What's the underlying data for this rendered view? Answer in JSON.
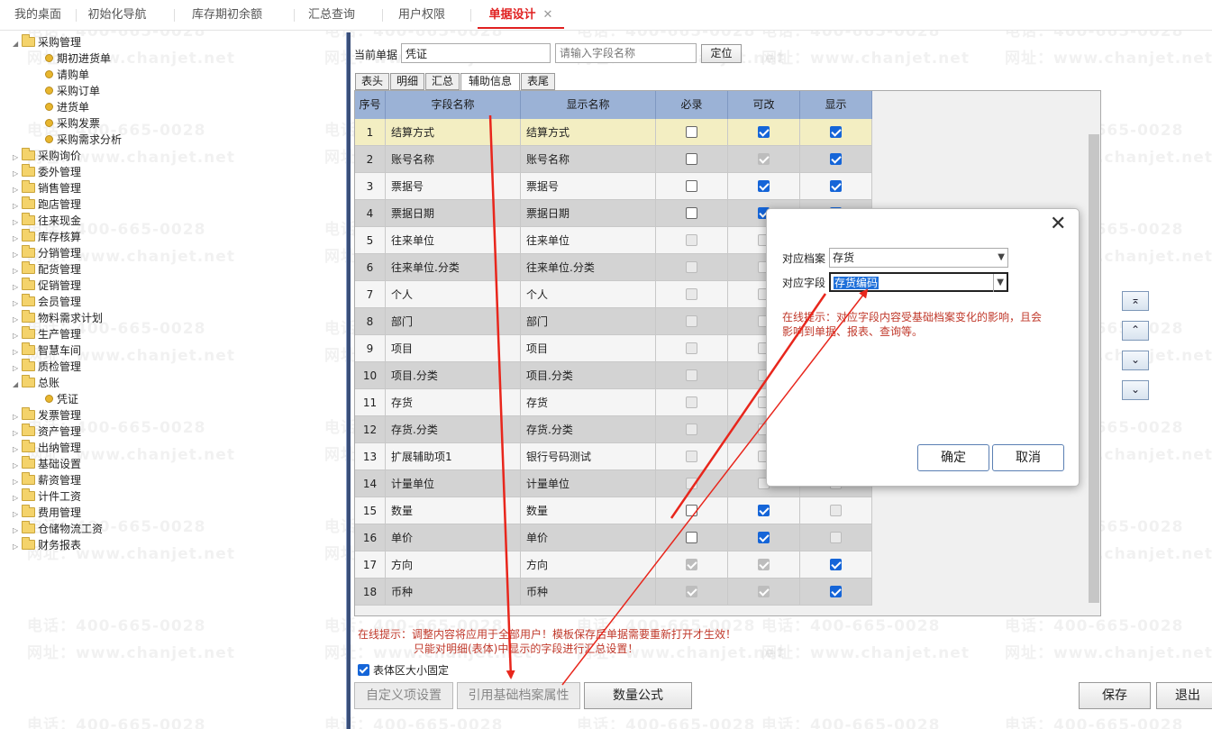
{
  "top_tabs": [
    {
      "label": "我的桌面",
      "active": false
    },
    {
      "label": "初始化导航",
      "active": false
    },
    {
      "label": "库存期初余额",
      "active": false
    },
    {
      "label": "汇总查询",
      "active": false
    },
    {
      "label": "用户权限",
      "active": false
    },
    {
      "label": "单据设计",
      "active": true
    }
  ],
  "tab_close_glyph": "✕",
  "tree": [
    {
      "label": "采购管理",
      "level": 0,
      "expanded": true
    },
    {
      "label": "期初进货单",
      "level": 1
    },
    {
      "label": "请购单",
      "level": 1
    },
    {
      "label": "采购订单",
      "level": 1
    },
    {
      "label": "进货单",
      "level": 1
    },
    {
      "label": "采购发票",
      "level": 1
    },
    {
      "label": "采购需求分析",
      "level": 1
    },
    {
      "label": "采购询价",
      "level": 0
    },
    {
      "label": "委外管理",
      "level": 0
    },
    {
      "label": "销售管理",
      "level": 0
    },
    {
      "label": "跑店管理",
      "level": 0
    },
    {
      "label": "往来现金",
      "level": 0
    },
    {
      "label": "库存核算",
      "level": 0
    },
    {
      "label": "分销管理",
      "level": 0
    },
    {
      "label": "配货管理",
      "level": 0
    },
    {
      "label": "促销管理",
      "level": 0
    },
    {
      "label": "会员管理",
      "level": 0
    },
    {
      "label": "物料需求计划",
      "level": 0
    },
    {
      "label": "生产管理",
      "level": 0
    },
    {
      "label": "智慧车间",
      "level": 0
    },
    {
      "label": "质检管理",
      "level": 0
    },
    {
      "label": "总账",
      "level": 0,
      "expanded": true
    },
    {
      "label": "凭证",
      "level": 1
    },
    {
      "label": "发票管理",
      "level": 0
    },
    {
      "label": "资产管理",
      "level": 0
    },
    {
      "label": "出纳管理",
      "level": 0
    },
    {
      "label": "基础设置",
      "level": 0
    },
    {
      "label": "薪资管理",
      "level": 0
    },
    {
      "label": "计件工资",
      "level": 0
    },
    {
      "label": "费用管理",
      "level": 0
    },
    {
      "label": "仓储物流工资",
      "level": 0
    },
    {
      "label": "财务报表",
      "level": 0
    }
  ],
  "current_doc": {
    "label": "当前单据",
    "value": "凭证",
    "field_search_placeholder": "请输入字段名称",
    "locate_button": "定位"
  },
  "sub_tabs": [
    {
      "label": "表头",
      "active": false
    },
    {
      "label": "明细",
      "active": false
    },
    {
      "label": "汇总",
      "active": false
    },
    {
      "label": "辅助信息",
      "active": true
    },
    {
      "label": "表尾",
      "active": false
    }
  ],
  "grid": {
    "columns": [
      "序号",
      "字段名称",
      "显示名称",
      "必录",
      "可改",
      "显示"
    ],
    "rows": [
      {
        "no": "1",
        "field": "结算方式",
        "display": "结算方式",
        "required": [
          false,
          true
        ],
        "editable": [
          true,
          true
        ],
        "visible": [
          true,
          true
        ],
        "selected": true
      },
      {
        "no": "2",
        "field": "账号名称",
        "display": "账号名称",
        "required": [
          false,
          true
        ],
        "editable": [
          true,
          false
        ],
        "visible": [
          true,
          true
        ]
      },
      {
        "no": "3",
        "field": "票据号",
        "display": "票据号",
        "required": [
          false,
          true
        ],
        "editable": [
          true,
          true
        ],
        "visible": [
          true,
          true
        ]
      },
      {
        "no": "4",
        "field": "票据日期",
        "display": "票据日期",
        "required": [
          false,
          true
        ],
        "editable": [
          true,
          true
        ],
        "visible": [
          true,
          true
        ]
      },
      {
        "no": "5",
        "field": "往来单位",
        "display": "往来单位",
        "required": [
          false,
          false
        ],
        "editable": [
          false,
          false
        ],
        "visible": [
          false,
          false
        ]
      },
      {
        "no": "6",
        "field": "往来单位.分类",
        "display": "往来单位.分类",
        "required": [
          false,
          false
        ],
        "editable": [
          false,
          false
        ],
        "visible": [
          false,
          false
        ]
      },
      {
        "no": "7",
        "field": "个人",
        "display": "个人",
        "required": [
          false,
          false
        ],
        "editable": [
          false,
          false
        ],
        "visible": [
          false,
          false
        ]
      },
      {
        "no": "8",
        "field": "部门",
        "display": "部门",
        "required": [
          false,
          false
        ],
        "editable": [
          false,
          false
        ],
        "visible": [
          false,
          false
        ]
      },
      {
        "no": "9",
        "field": "项目",
        "display": "项目",
        "required": [
          false,
          false
        ],
        "editable": [
          false,
          false
        ],
        "visible": [
          false,
          false
        ]
      },
      {
        "no": "10",
        "field": "项目.分类",
        "display": "项目.分类",
        "required": [
          false,
          false
        ],
        "editable": [
          false,
          false
        ],
        "visible": [
          false,
          false
        ]
      },
      {
        "no": "11",
        "field": "存货",
        "display": "存货",
        "required": [
          false,
          false
        ],
        "editable": [
          false,
          false
        ],
        "visible": [
          false,
          false
        ]
      },
      {
        "no": "12",
        "field": "存货.分类",
        "display": "存货.分类",
        "required": [
          false,
          false
        ],
        "editable": [
          false,
          false
        ],
        "visible": [
          false,
          false
        ]
      },
      {
        "no": "13",
        "field": "扩展辅助项1",
        "display": "银行号码测试",
        "required": [
          false,
          false
        ],
        "editable": [
          false,
          false
        ],
        "visible": [
          false,
          false
        ]
      },
      {
        "no": "14",
        "field": "计量单位",
        "display": "计量单位",
        "required": [
          false,
          false
        ],
        "editable": [
          false,
          false
        ],
        "visible": [
          false,
          false
        ]
      },
      {
        "no": "15",
        "field": "数量",
        "display": "数量",
        "required": [
          false,
          true
        ],
        "editable": [
          true,
          true
        ],
        "visible": [
          false,
          false
        ]
      },
      {
        "no": "16",
        "field": "单价",
        "display": "单价",
        "required": [
          false,
          true
        ],
        "editable": [
          true,
          true
        ],
        "visible": [
          false,
          false
        ]
      },
      {
        "no": "17",
        "field": "方向",
        "display": "方向",
        "required": [
          true,
          false
        ],
        "editable": [
          true,
          false
        ],
        "visible": [
          true,
          true
        ]
      },
      {
        "no": "18",
        "field": "币种",
        "display": "币种",
        "required": [
          true,
          false
        ],
        "editable": [
          true,
          false
        ],
        "visible": [
          true,
          true
        ]
      }
    ]
  },
  "move_buttons": [
    "⌅",
    "⌃",
    "⌄",
    "⌄"
  ],
  "bottom_tip": [
    "在线提示：调整内容将应用于全部用户！模板保存后单据需要重新打开才生效！",
    "只能对明细(表体)中显示的字段进行汇总设置！"
  ],
  "fixed_size_label": "表体区大小固定",
  "bottom_buttons": {
    "custom_item": "自定义项设置",
    "ref_base_attr": "引用基础档案属性",
    "qty_formula": "数量公式",
    "save": "保存",
    "exit": "退出"
  },
  "dialog": {
    "close_glyph": "✕",
    "archive_label": "对应档案",
    "archive_value": "存货",
    "field_label": "对应字段",
    "field_value": "存货编码",
    "tip": "在线提示：对应字段内容受基础档案变化的影响，且会影响到单据、报表、查询等。",
    "ok": "确定",
    "cancel": "取消"
  },
  "watermark": [
    "电话：400-665-0028",
    "网址：www.chanjet.net"
  ],
  "colors": {
    "accent_red": "#e02020",
    "header_blue": "#9bb2d6",
    "check_blue": "#1565d8",
    "tip_red": "#c0392b",
    "annotation_red": "#e8261c"
  }
}
